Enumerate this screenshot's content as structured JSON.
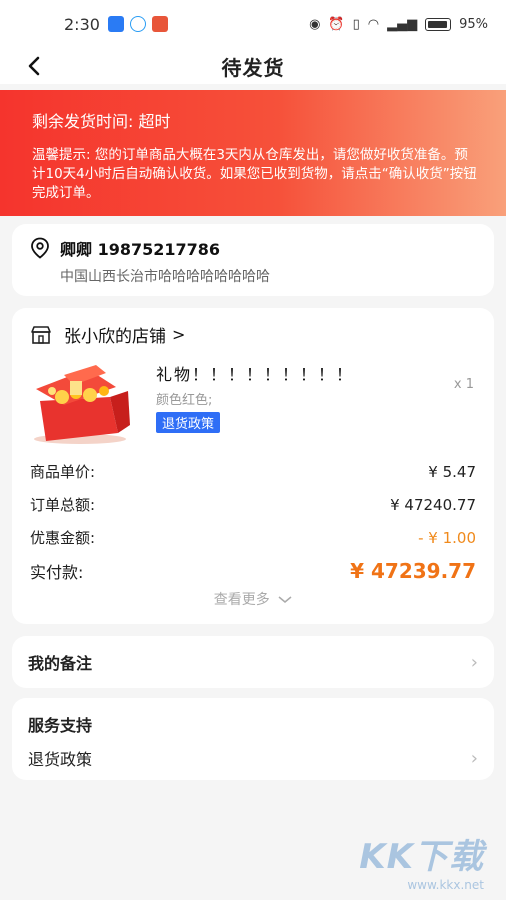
{
  "status_bar": {
    "time": "2:30",
    "battery": "95%"
  },
  "nav": {
    "title": "待发货"
  },
  "banner": {
    "title": "剩余发货时间:  超时",
    "tip": "温馨提示:  您的订单商品大概在3天内从仓库发出，请您做好收货准备。预计10天4小时后自动确认收货。如果您已收到货物，请点击“确认收货”按钮完成订单。"
  },
  "address": {
    "name_phone": "卿卿  19875217786",
    "detail": "中国山西长治市哈哈哈哈哈哈哈哈"
  },
  "shop": {
    "name": "张小欣的店铺",
    "chevron": ">"
  },
  "product": {
    "name": "礼物！！！！！！！！！",
    "spec": "颜色红色;",
    "policy_tag": "退货政策",
    "quantity": "x 1"
  },
  "prices": {
    "unit_label": "商品单价:",
    "unit_value": "¥  5.47",
    "total_label": "订单总额:",
    "total_value": "¥  47240.77",
    "discount_label": "优惠金额:",
    "discount_value": "- ¥ 1.00",
    "paid_label": "实付款:",
    "paid_value": "¥ 47239.77"
  },
  "more": "查看更多",
  "remark": {
    "label": "我的备注"
  },
  "service": {
    "title": "服务支持",
    "item": "退货政策"
  },
  "watermark": {
    "logo": "KK下载",
    "url": "www.kkx.net"
  },
  "colors": {
    "banner_start": "#f5342d",
    "banner_end": "#f9a07a",
    "accent_orange": "#f07316",
    "tag_blue": "#2f6ef6"
  }
}
